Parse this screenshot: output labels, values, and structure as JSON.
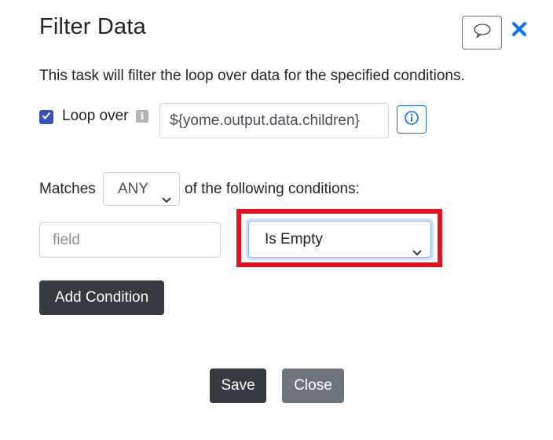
{
  "dialog": {
    "title": "Filter Data",
    "description": "This task will filter the loop over data for the specified conditions.",
    "loop_over_label": "Loop over",
    "loop_over_checked": true,
    "loop_over_value": "${yome.output.data.children}",
    "matches_prefix": "Matches",
    "matches_mode": "ANY",
    "matches_suffix": "of the following conditions:",
    "condition": {
      "field_placeholder": "field",
      "operator": "Is Empty"
    },
    "add_condition_label": "Add Condition",
    "save_label": "Save",
    "close_label": "Close"
  },
  "icons": {
    "comment": "speech-bubble-icon",
    "close": "close-x-icon",
    "info_small": "info-square-icon",
    "info_circle": "info-circle-icon",
    "checkbox": "checkmark-icon",
    "chevron": "chevron-down-icon"
  },
  "colors": {
    "primary": "#0d6efd",
    "dark_button": "#343a40",
    "secondary_button": "#6c757d",
    "checkbox": "#3b4fb8",
    "highlight": "#e3141f"
  }
}
